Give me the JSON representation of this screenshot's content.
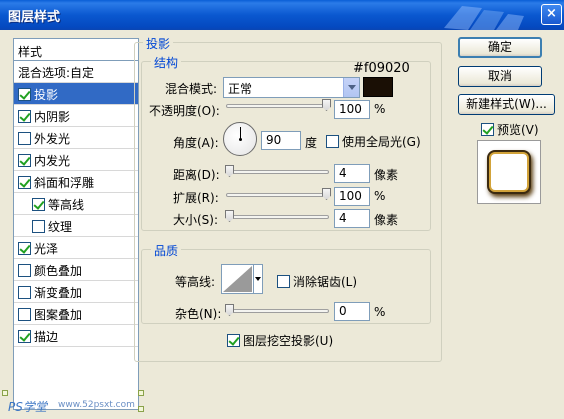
{
  "window": {
    "title": "图层样式",
    "close_glyph": "×"
  },
  "sidebar": {
    "header": "样式",
    "items": [
      {
        "label": "混合选项:自定",
        "checkbox": false,
        "checked": false,
        "indent": false,
        "selected": false
      },
      {
        "label": "投影",
        "checkbox": true,
        "checked": true,
        "indent": false,
        "selected": true
      },
      {
        "label": "内阴影",
        "checkbox": true,
        "checked": true,
        "indent": false,
        "selected": false
      },
      {
        "label": "外发光",
        "checkbox": true,
        "checked": false,
        "indent": false,
        "selected": false
      },
      {
        "label": "内发光",
        "checkbox": true,
        "checked": true,
        "indent": false,
        "selected": false
      },
      {
        "label": "斜面和浮雕",
        "checkbox": true,
        "checked": true,
        "indent": false,
        "selected": false
      },
      {
        "label": "等高线",
        "checkbox": true,
        "checked": true,
        "indent": true,
        "selected": false
      },
      {
        "label": "纹理",
        "checkbox": true,
        "checked": false,
        "indent": true,
        "selected": false
      },
      {
        "label": "光泽",
        "checkbox": true,
        "checked": true,
        "indent": false,
        "selected": false
      },
      {
        "label": "颜色叠加",
        "checkbox": true,
        "checked": false,
        "indent": false,
        "selected": false
      },
      {
        "label": "渐变叠加",
        "checkbox": true,
        "checked": false,
        "indent": false,
        "selected": false
      },
      {
        "label": "图案叠加",
        "checkbox": true,
        "checked": false,
        "indent": false,
        "selected": false
      },
      {
        "label": "描边",
        "checkbox": true,
        "checked": true,
        "indent": false,
        "selected": false
      }
    ]
  },
  "drop_shadow": {
    "title": "投影",
    "structure": {
      "title": "结构",
      "color_code": "#f09020",
      "blend_mode_label": "混合模式:",
      "blend_mode_value": "正常",
      "shadow_color": "#1a0f05",
      "opacity_label": "不透明度(O):",
      "opacity_value": "100",
      "opacity_unit": "%",
      "opacity_level": 1.0,
      "angle_label": "角度(A):",
      "angle_value": "90",
      "angle_unit": "度",
      "global_light_label": "使用全局光(G)",
      "global_light_checked": false,
      "distance_label": "距离(D):",
      "distance_value": "4",
      "distance_unit": "像素",
      "distance_level": 0.0,
      "spread_label": "扩展(R):",
      "spread_value": "100",
      "spread_unit": "%",
      "spread_level": 1.0,
      "size_label": "大小(S):",
      "size_value": "4",
      "size_unit": "像素",
      "size_level": 0.0
    },
    "quality": {
      "title": "品质",
      "contour_label": "等高线:",
      "antialias_label": "消除锯齿(L)",
      "antialias_checked": false,
      "noise_label": "杂色(N):",
      "noise_value": "0",
      "noise_unit": "%",
      "noise_level": 0.0
    },
    "knockout_label": "图层挖空投影(U)",
    "knockout_checked": true
  },
  "buttons": {
    "ok": "确定",
    "cancel": "取消",
    "new_style": "新建样式(W)...",
    "preview_label": "预览(V)",
    "preview_checked": true
  },
  "watermark": {
    "brand": "PS学堂",
    "site": "www.52psxt.com"
  }
}
